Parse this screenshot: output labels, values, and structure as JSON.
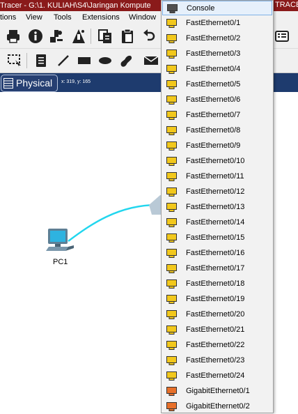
{
  "window": {
    "title": "Tracer - G:\\1. KULIAH\\S4\\Jaringan Kompute",
    "title_right": "TRACER"
  },
  "menu": {
    "items": [
      "tions",
      "View",
      "Tools",
      "Extensions",
      "Window"
    ]
  },
  "workspace": {
    "mode_label": "Physical",
    "coordinates": "x: 319, y: 165"
  },
  "devices": {
    "pc_label": "PC1"
  },
  "colors": {
    "fastethernet_port": "#f2c81c",
    "gigabit_port": "#e8702a",
    "console_port": "#505050",
    "link": "#22d6ee",
    "titlebar": "#8a1a1a",
    "physbar": "#1e3b6e"
  },
  "port_menu": {
    "items": [
      {
        "label": "Console",
        "icon": "console-port-icon"
      },
      {
        "label": "FastEthernet0/1",
        "icon": "fastethernet-port-icon"
      },
      {
        "label": "FastEthernet0/2",
        "icon": "fastethernet-port-icon"
      },
      {
        "label": "FastEthernet0/3",
        "icon": "fastethernet-port-icon"
      },
      {
        "label": "FastEthernet0/4",
        "icon": "fastethernet-port-icon"
      },
      {
        "label": "FastEthernet0/5",
        "icon": "fastethernet-port-icon"
      },
      {
        "label": "FastEthernet0/6",
        "icon": "fastethernet-port-icon"
      },
      {
        "label": "FastEthernet0/7",
        "icon": "fastethernet-port-icon"
      },
      {
        "label": "FastEthernet0/8",
        "icon": "fastethernet-port-icon"
      },
      {
        "label": "FastEthernet0/9",
        "icon": "fastethernet-port-icon"
      },
      {
        "label": "FastEthernet0/10",
        "icon": "fastethernet-port-icon"
      },
      {
        "label": "FastEthernet0/11",
        "icon": "fastethernet-port-icon"
      },
      {
        "label": "FastEthernet0/12",
        "icon": "fastethernet-port-icon"
      },
      {
        "label": "FastEthernet0/13",
        "icon": "fastethernet-port-icon"
      },
      {
        "label": "FastEthernet0/14",
        "icon": "fastethernet-port-icon"
      },
      {
        "label": "FastEthernet0/15",
        "icon": "fastethernet-port-icon"
      },
      {
        "label": "FastEthernet0/16",
        "icon": "fastethernet-port-icon"
      },
      {
        "label": "FastEthernet0/17",
        "icon": "fastethernet-port-icon"
      },
      {
        "label": "FastEthernet0/18",
        "icon": "fastethernet-port-icon"
      },
      {
        "label": "FastEthernet0/19",
        "icon": "fastethernet-port-icon"
      },
      {
        "label": "FastEthernet0/20",
        "icon": "fastethernet-port-icon"
      },
      {
        "label": "FastEthernet0/21",
        "icon": "fastethernet-port-icon"
      },
      {
        "label": "FastEthernet0/22",
        "icon": "fastethernet-port-icon"
      },
      {
        "label": "FastEthernet0/23",
        "icon": "fastethernet-port-icon"
      },
      {
        "label": "FastEthernet0/24",
        "icon": "fastethernet-port-icon"
      },
      {
        "label": "GigabitEthernet0/1",
        "icon": "gigabit-port-icon"
      },
      {
        "label": "GigabitEthernet0/2",
        "icon": "gigabit-port-icon"
      }
    ]
  }
}
